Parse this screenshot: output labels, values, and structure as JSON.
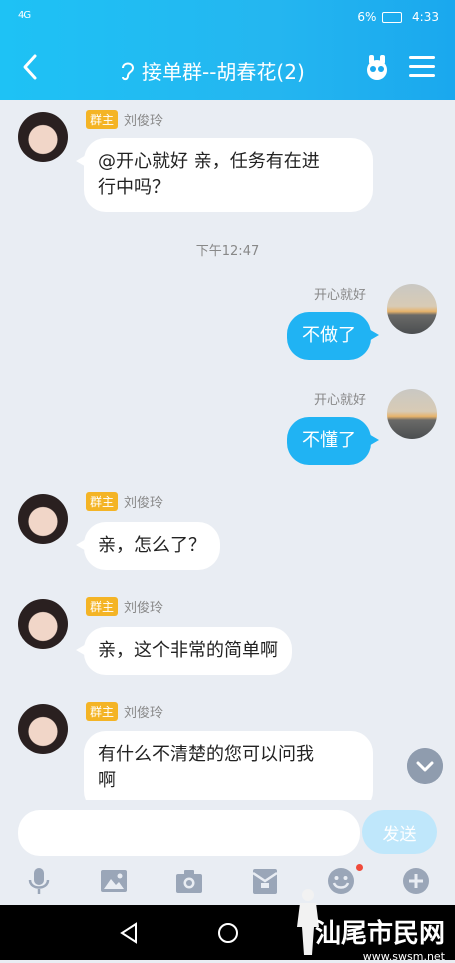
{
  "status_bar": {
    "signal": "4G",
    "battery": "6%",
    "time": "4:33"
  },
  "header": {
    "title": "接单群--胡春花(2)"
  },
  "messages": [
    {
      "sender_badge": "群主",
      "sender_name": "刘俊玲",
      "text_line1": "@开心就好 亲，任务有在进",
      "text_line2": "行中吗？"
    },
    {
      "timestamp": "下午12:47"
    },
    {
      "sender_name": "开心就好",
      "text": "不做了"
    },
    {
      "sender_name": "开心就好",
      "text": "不懂了"
    },
    {
      "sender_badge": "群主",
      "sender_name": "刘俊玲",
      "text": "亲，怎么了？"
    },
    {
      "sender_badge": "群主",
      "sender_name": "刘俊玲",
      "text": "亲，这个非常的简单啊"
    },
    {
      "sender_badge": "群主",
      "sender_name": "刘俊玲",
      "text_line1": "有什么不清楚的您可以问我",
      "text_line2": "啊"
    }
  ],
  "composer": {
    "input_value": "",
    "send_label": "发送"
  },
  "toolbar_icons": [
    "microphone-icon",
    "image-icon",
    "camera-icon",
    "red-packet-icon",
    "emoji-icon",
    "plus-icon"
  ],
  "watermark": {
    "name": "汕尾市民网",
    "url": "www.swsm.net"
  },
  "colors": {
    "header": "#1ec2f5",
    "my_bubble": "#20b3f3",
    "badge": "#f4b425",
    "background": "#e9edf3"
  }
}
